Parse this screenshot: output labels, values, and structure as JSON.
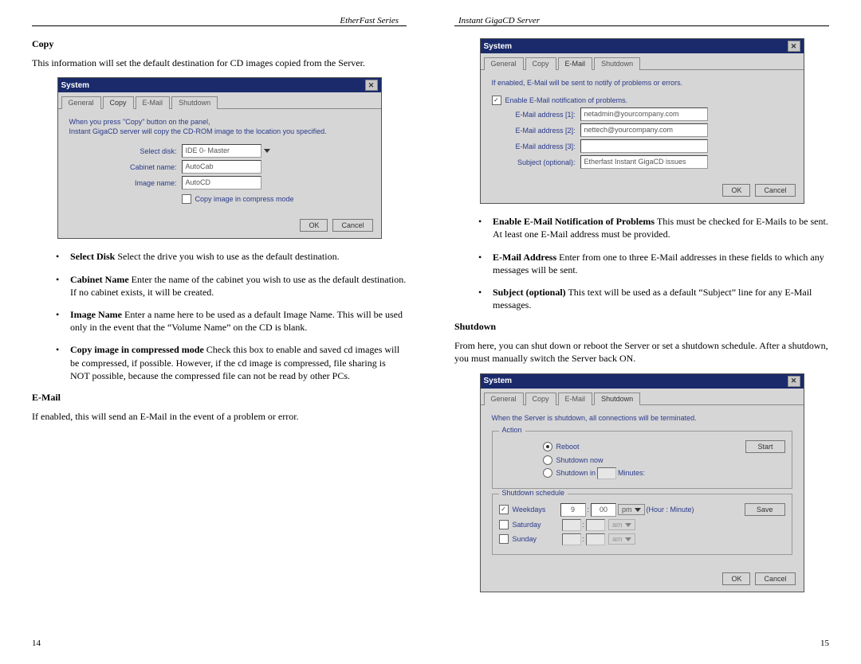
{
  "left": {
    "header": "EtherFast Series",
    "page_num": "14",
    "sec_copy": "Copy",
    "copy_intro": "This information will set the default destination for CD images copied from the Server.",
    "dlg1": {
      "title": "System",
      "tabs": [
        "General",
        "Copy",
        "E-Mail",
        "Shutdown"
      ],
      "active_tab": 1,
      "hint1": "When you press \"Copy\" button on the panel,",
      "hint2": "Instant GigaCD server will copy the CD-ROM image to the location you specified.",
      "lbl_select_disk": "Select disk:",
      "val_select_disk": "IDE 0- Master",
      "lbl_cabinet": "Cabinet name:",
      "val_cabinet": "AutoCab",
      "lbl_image": "Image name:",
      "val_image": "AutoCD",
      "chk_compress": "Copy image in compress mode",
      "ok": "OK",
      "cancel": "Cancel"
    },
    "bullets": [
      {
        "b": "Select Disk",
        "t": " Select the drive you wish to use as the default destination."
      },
      {
        "b": "Cabinet Name",
        "t": " Enter the name of the cabinet you wish to use as the default destination. If no cabinet exists, it will be created."
      },
      {
        "b": "Image Name",
        "t": " Enter a name here to be used as a default Image Name. This will be used only in the event that the “Volume Name” on the CD is blank."
      },
      {
        "b": "Copy image in compressed mode",
        "t": " Check this box to enable and saved cd images will be compressed, if possible. However, if the cd image is compressed, file sharing is NOT possible, because the compressed file can not be read by other PCs."
      }
    ],
    "sec_email": "E-Mail",
    "email_intro": "If enabled, this will send an E-Mail in the event of a problem or error."
  },
  "right": {
    "header": "Instant GigaCD Server",
    "page_num": "15",
    "dlg2": {
      "title": "System",
      "tabs": [
        "General",
        "Copy",
        "E-Mail",
        "Shutdown"
      ],
      "active_tab": 2,
      "hint": "If enabled, E-Mail will be sent to notify of problems or errors.",
      "chk_enable": "Enable E-Mail notification of problems.",
      "lbl_e1": "E-Mail address [1]:",
      "val_e1": "netadmin@yourcompany.com",
      "lbl_e2": "E-Mail address [2]:",
      "val_e2": "nettech@yourcompany.com",
      "lbl_e3": "E-Mail address [3]:",
      "val_e3": "",
      "lbl_subj": "Subject (optional):",
      "val_subj": "Etherfast Instant GigaCD issues",
      "ok": "OK",
      "cancel": "Cancel"
    },
    "bullets": [
      {
        "b": "Enable E-Mail Notification of Problems",
        "t": " This must be checked for E-Mails to be sent. At least one E-Mail address must be provided."
      },
      {
        "b": "E-Mail Address",
        "t": " Enter from one to three E-Mail addresses in these fields to which any messages will be sent."
      },
      {
        "b": "Subject (optional)",
        "t": " This text will be used as a default “Subject” line for any E-Mail messages."
      }
    ],
    "sec_shutdown": "Shutdown",
    "shutdown_intro": "From here, you can shut down or reboot the Server or set a shutdown schedule. After a shutdown, you must manually switch the Server back ON.",
    "dlg3": {
      "title": "System",
      "tabs": [
        "General",
        "Copy",
        "E-Mail",
        "Shutdown"
      ],
      "active_tab": 3,
      "hint": "When the Server is shutdown, all connections will be terminated.",
      "grp_action": "Action",
      "opt_reboot": "Reboot",
      "opt_shutdown_now": "Shutdown now",
      "opt_shutdown_in": "Shutdown in",
      "lbl_minutes": "Minutes:",
      "btn_start": "Start",
      "grp_sched": "Shutdown schedule",
      "chk_weekdays": "Weekdays",
      "chk_saturday": "Saturday",
      "chk_sunday": "Sunday",
      "val_hour": "9",
      "val_min": "00",
      "val_ampm": "pm",
      "lbl_hm": "(Hour : Minute)",
      "btn_save": "Save",
      "ok": "OK",
      "cancel": "Cancel"
    }
  }
}
